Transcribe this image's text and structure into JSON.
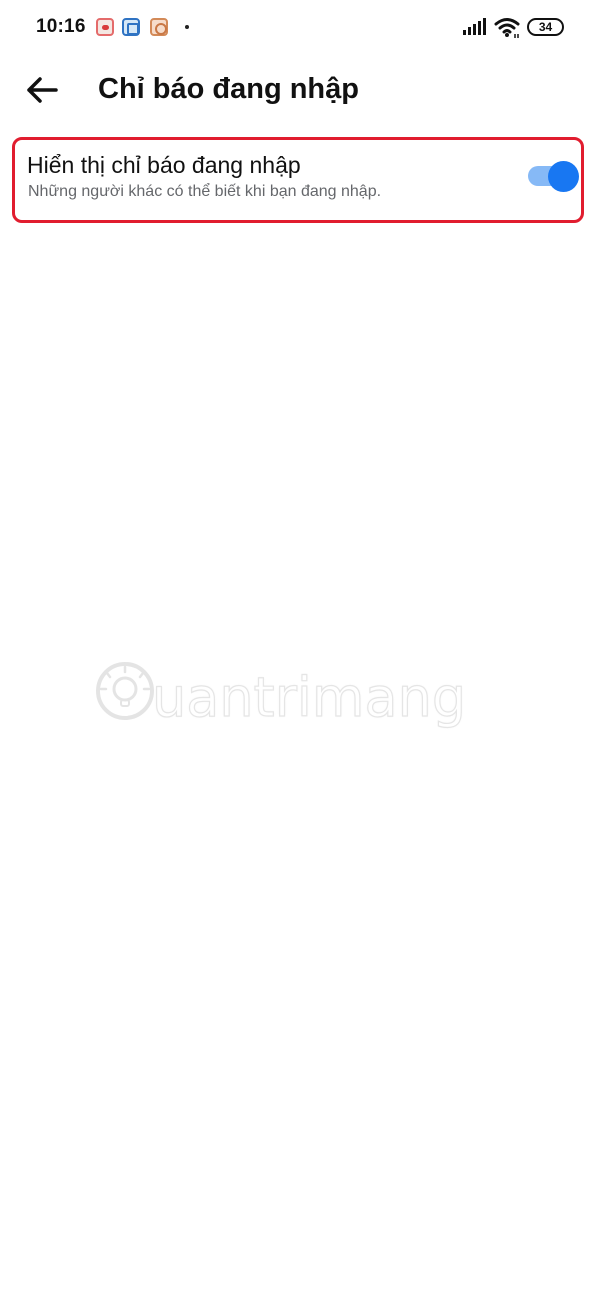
{
  "status_bar": {
    "time": "10:16",
    "battery_level": "34",
    "icons": [
      "app-notification-icon-red",
      "app-notification-icon-blue",
      "app-notification-icon-orange",
      "notification-dot-icon",
      "signal-icon",
      "wifi-icon",
      "battery-icon"
    ]
  },
  "header": {
    "back_icon": "arrow-left-icon",
    "title": "Chỉ báo đang nhập"
  },
  "settings": [
    {
      "title": "Hiển thị chỉ báo đang nhập",
      "description": "Những người khác có thể biết khi bạn đang nhập.",
      "enabled": true
    }
  ],
  "watermark": {
    "text": "uantrimang"
  },
  "colors": {
    "accent": "#1877f2",
    "highlight_border": "#e11d2f",
    "secondary_text": "#65676b"
  }
}
